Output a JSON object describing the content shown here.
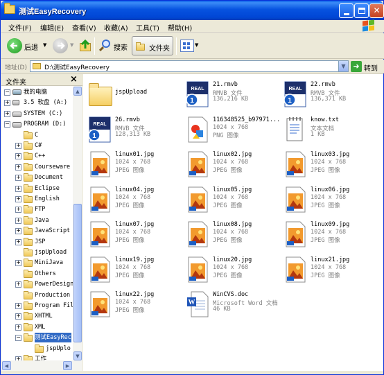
{
  "window": {
    "title": "测试EasyRecovery"
  },
  "menu": [
    "文件(F)",
    "编辑(E)",
    "查看(V)",
    "收藏(A)",
    "工具(T)",
    "帮助(H)"
  ],
  "toolbar": {
    "back": "后退",
    "search": "搜索",
    "folders": "文件夹"
  },
  "address": {
    "label": "地址(D)",
    "value": "D:\\测试EasyRecovery",
    "go": "转到"
  },
  "sidebar": {
    "title": "文件夹",
    "close": "×",
    "tree": [
      {
        "label": "我的电脑",
        "expander": "−"
      },
      {
        "label": "3.5 软盘 (A:)",
        "expander": "+"
      },
      {
        "label": "SYSTEM (C:)",
        "expander": "+"
      },
      {
        "label": "PROGRAM (D:)",
        "expander": "−"
      },
      {
        "label": "C",
        "expander": ""
      },
      {
        "label": "C#",
        "expander": "+"
      },
      {
        "label": "C++",
        "expander": "+"
      },
      {
        "label": "Courseware",
        "expander": "+"
      },
      {
        "label": "Document",
        "expander": "+"
      },
      {
        "label": "Eclipse",
        "expander": "+"
      },
      {
        "label": "English",
        "expander": "+"
      },
      {
        "label": "FTP",
        "expander": "+"
      },
      {
        "label": "Java",
        "expander": "+"
      },
      {
        "label": "JavaScript",
        "expander": "+"
      },
      {
        "label": "JSP",
        "expander": "+"
      },
      {
        "label": "jspUpload",
        "expander": ""
      },
      {
        "label": "MiniJava",
        "expander": "+"
      },
      {
        "label": "Others",
        "expander": ""
      },
      {
        "label": "PowerDesign",
        "expander": "+"
      },
      {
        "label": "Production",
        "expander": ""
      },
      {
        "label": "Program Fil",
        "expander": "+"
      },
      {
        "label": "XHTML",
        "expander": "+"
      },
      {
        "label": "XML",
        "expander": "+"
      },
      {
        "label": "测试EasyRec",
        "expander": "−"
      },
      {
        "label": "jspUplo",
        "expander": ""
      },
      {
        "label": "工作",
        "expander": "+"
      }
    ]
  },
  "files": [
    {
      "name": "jspUpload",
      "type": "",
      "size": "",
      "icon": "folder-icon"
    },
    {
      "name": "21.rmvb",
      "type": "RMVB 文件",
      "size": "136,216 KB",
      "icon": "real-media-icon"
    },
    {
      "name": "22.rmvb",
      "type": "RMVB 文件",
      "size": "136,371 KB",
      "icon": "real-media-icon"
    },
    {
      "name": "26.rmvb",
      "type": "RMVB 文件",
      "size": "128,313 KB",
      "icon": "real-media-icon"
    },
    {
      "name": "116348525_b97971...",
      "type": "1024 x 768",
      "size": "PNG 图像",
      "icon": "png-icon"
    },
    {
      "name": "know.txt",
      "type": "文本文档",
      "size": "1 KB",
      "icon": "text-file-icon"
    },
    {
      "name": "linux01.jpg",
      "type": "1024 x 768",
      "size": "JPEG 图像",
      "icon": "jpeg-icon"
    },
    {
      "name": "linux02.jpg",
      "type": "1024 x 768",
      "size": "JPEG 图像",
      "icon": "jpeg-icon"
    },
    {
      "name": "linux03.jpg",
      "type": "1024 x 768",
      "size": "JPEG 图像",
      "icon": "jpeg-icon"
    },
    {
      "name": "linux04.jpg",
      "type": "1024 x 768",
      "size": "JPEG 图像",
      "icon": "jpeg-icon"
    },
    {
      "name": "linux05.jpg",
      "type": "1024 x 768",
      "size": "JPEG 图像",
      "icon": "jpeg-icon"
    },
    {
      "name": "linux06.jpg",
      "type": "1024 x 768",
      "size": "JPEG 图像",
      "icon": "jpeg-icon"
    },
    {
      "name": "linux07.jpg",
      "type": "1024 x 768",
      "size": "JPEG 图像",
      "icon": "jpeg-icon"
    },
    {
      "name": "linux08.jpg",
      "type": "1024 x 768",
      "size": "JPEG 图像",
      "icon": "jpeg-icon"
    },
    {
      "name": "linux09.jpg",
      "type": "1024 x 768",
      "size": "JPEG 图像",
      "icon": "jpeg-icon"
    },
    {
      "name": "linux19.jpg",
      "type": "1024 x 768",
      "size": "JPEG 图像",
      "icon": "jpeg-icon"
    },
    {
      "name": "linux20.jpg",
      "type": "1024 x 768",
      "size": "JPEG 图像",
      "icon": "jpeg-icon"
    },
    {
      "name": "linux21.jpg",
      "type": "1024 x 768",
      "size": "JPEG 图像",
      "icon": "jpeg-icon"
    },
    {
      "name": "linux22.jpg",
      "type": "1024 x 768",
      "size": "JPEG 图像",
      "icon": "jpeg-icon"
    },
    {
      "name": "WinCVS.doc",
      "type": "Microsoft Word 文档",
      "size": "46 KB",
      "icon": "word-doc-icon"
    }
  ]
}
